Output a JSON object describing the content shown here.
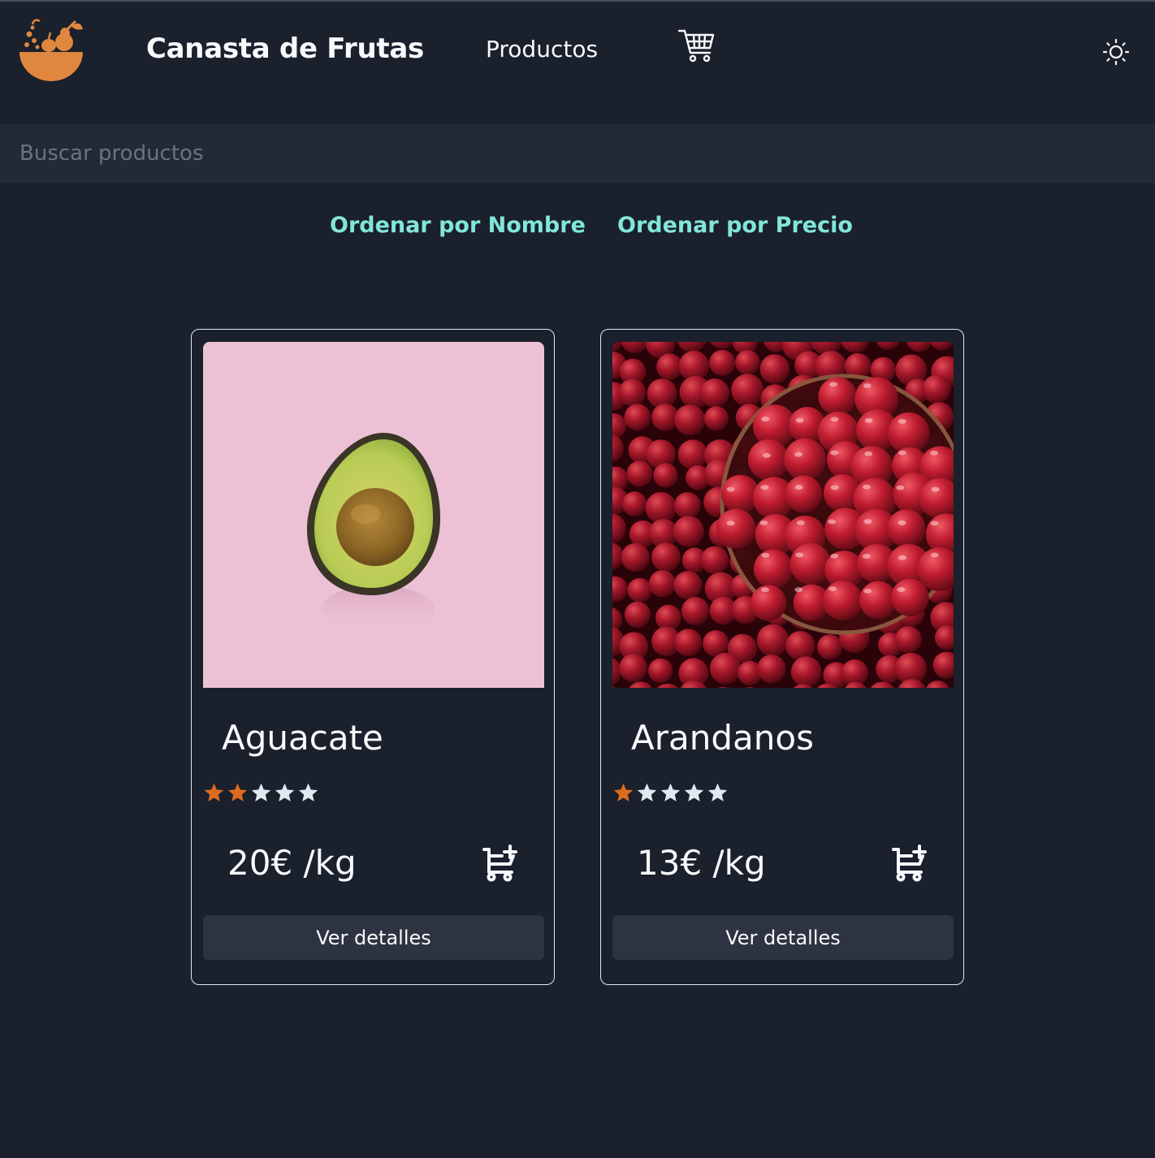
{
  "header": {
    "brand": "Canasta de Frutas",
    "nav_link": "Productos",
    "logo_icon": "fruit-basket-icon",
    "cart_icon": "shopping-cart-icon",
    "theme_icon": "sun-icon"
  },
  "search": {
    "placeholder": "Buscar productos",
    "value": ""
  },
  "sort": {
    "by_name": "Ordenar por Nombre",
    "by_price": "Ordenar por Precio"
  },
  "products": [
    {
      "name": "Aguacate",
      "rating": 2,
      "max_rating": 5,
      "price": "20€ /kg",
      "details_label": "Ver detalles",
      "image": "avocado-half-on-pink"
    },
    {
      "name": "Arandanos",
      "rating": 1,
      "max_rating": 5,
      "price": "13€ /kg",
      "details_label": "Ver detalles",
      "image": "cranberries-in-glass-bowl"
    }
  ],
  "colors": {
    "background": "#1a202c",
    "accent": "#81e6d9",
    "brand_orange": "#e0873f",
    "star_filled": "#dd6b20",
    "star_empty": "#e2e8f0"
  }
}
